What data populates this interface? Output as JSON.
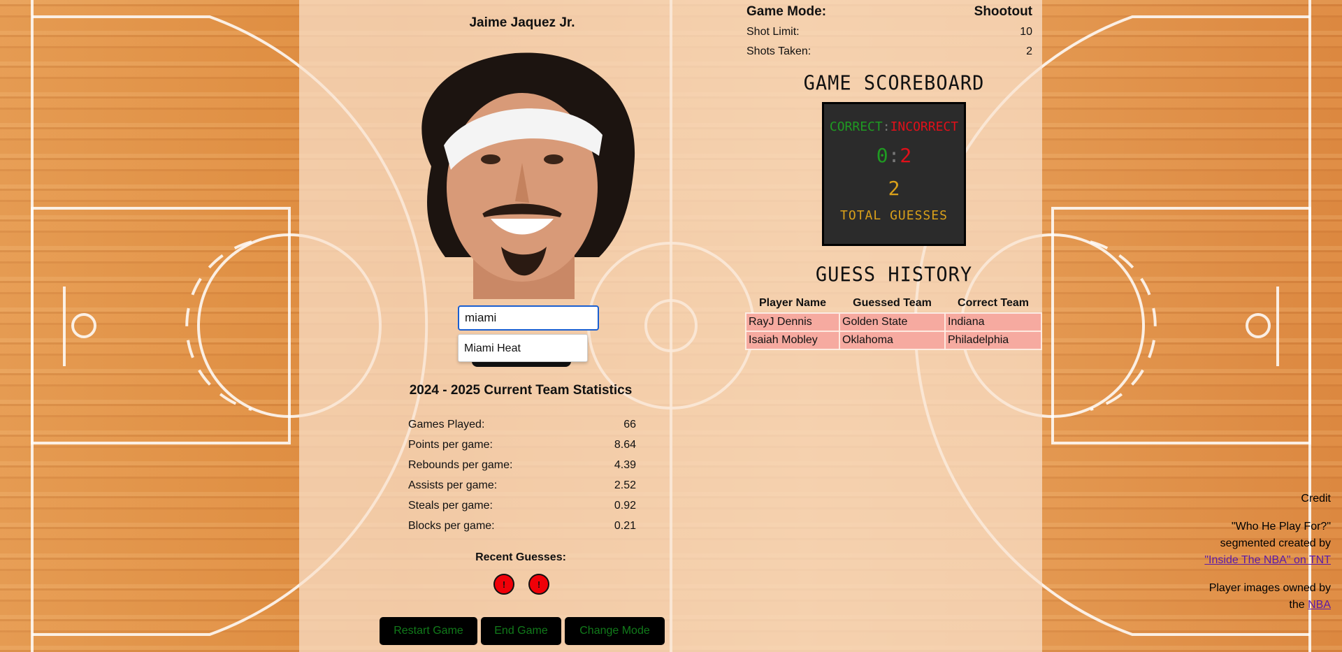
{
  "player": {
    "name": "Jaime Jaquez Jr."
  },
  "guess_input": {
    "value": "miami"
  },
  "autocomplete": {
    "options": [
      "Miami Heat"
    ]
  },
  "stats": {
    "title": "2024 - 2025 Current Team Statistics",
    "rows": [
      {
        "label": "Games Played:",
        "value": "66"
      },
      {
        "label": "Points per game:",
        "value": "8.64"
      },
      {
        "label": "Rebounds per game:",
        "value": "4.39"
      },
      {
        "label": "Assists per game:",
        "value": "2.52"
      },
      {
        "label": "Steals per game:",
        "value": "0.92"
      },
      {
        "label": "Blocks per game:",
        "value": "0.21"
      }
    ]
  },
  "recent_guesses": {
    "title": "Recent Guesses:",
    "items": [
      {
        "mark": "!",
        "result": "incorrect"
      },
      {
        "mark": "!",
        "result": "incorrect"
      }
    ]
  },
  "buttons": {
    "restart": "Restart Game",
    "end": "End Game",
    "change_mode": "Change Mode"
  },
  "game_info": {
    "mode_label": "Game Mode:",
    "mode_value": "Shootout",
    "shot_limit_label": "Shot Limit:",
    "shot_limit_value": "10",
    "shots_taken_label": "Shots Taken:",
    "shots_taken_value": "2"
  },
  "scoreboard": {
    "title": "GAME SCOREBOARD",
    "correct_label": "CORRECT",
    "separator": ":",
    "incorrect_label": "INCORRECT",
    "correct": "0",
    "incorrect": "2",
    "total": "2",
    "total_label": "TOTAL GUESSES"
  },
  "history": {
    "title": "GUESS HISTORY",
    "columns": [
      "Player Name",
      "Guessed Team",
      "Correct Team"
    ],
    "rows": [
      {
        "player": "RayJ Dennis",
        "guessed": "Golden State",
        "correct": "Indiana"
      },
      {
        "player": "Isaiah Mobley",
        "guessed": "Oklahoma",
        "correct": "Philadelphia"
      }
    ]
  },
  "credit": {
    "title": "Credit",
    "line1": "\"Who He Play For?\" segmented created by",
    "link1": "\"Inside The NBA\" on TNT",
    "line2": "Player images owned by the",
    "link2": "NBA"
  },
  "colors": {
    "correct": "#1f9a22",
    "incorrect": "#e0101a",
    "total": "#d9a01a",
    "button_text": "#117a1a",
    "history_row": "#f6aaa0"
  }
}
